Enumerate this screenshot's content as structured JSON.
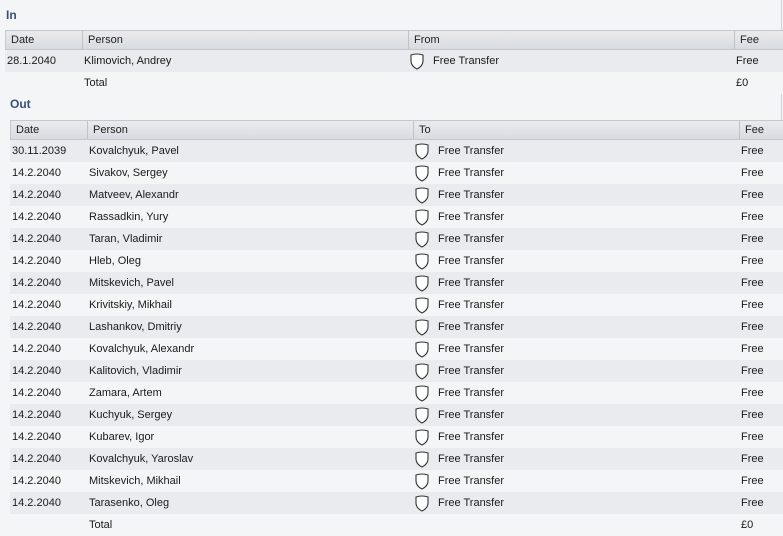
{
  "in_section": {
    "title": "In",
    "headers": {
      "date": "Date",
      "person": "Person",
      "club": "From",
      "fee": "Fee"
    },
    "rows": [
      {
        "date": "28.1.2040",
        "person": "Klimovich, Andrey",
        "club": "Free Transfer",
        "fee": "Free"
      }
    ],
    "total_label": "Total",
    "total_fee": "£0"
  },
  "out_section": {
    "title": "Out",
    "headers": {
      "date": "Date",
      "person": "Person",
      "club": "To",
      "fee": "Fee"
    },
    "rows": [
      {
        "date": "30.11.2039",
        "person": "Kovalchyuk, Pavel",
        "club": "Free Transfer",
        "fee": "Free"
      },
      {
        "date": "14.2.2040",
        "person": "Sivakov, Sergey",
        "club": "Free Transfer",
        "fee": "Free"
      },
      {
        "date": "14.2.2040",
        "person": "Matveev, Alexandr",
        "club": "Free Transfer",
        "fee": "Free"
      },
      {
        "date": "14.2.2040",
        "person": "Rassadkin, Yury",
        "club": "Free Transfer",
        "fee": "Free"
      },
      {
        "date": "14.2.2040",
        "person": "Taran, Vladimir",
        "club": "Free Transfer",
        "fee": "Free"
      },
      {
        "date": "14.2.2040",
        "person": "Hleb, Oleg",
        "club": "Free Transfer",
        "fee": "Free"
      },
      {
        "date": "14.2.2040",
        "person": "Mitskevich, Pavel",
        "club": "Free Transfer",
        "fee": "Free"
      },
      {
        "date": "14.2.2040",
        "person": "Krivitskiy, Mikhail",
        "club": "Free Transfer",
        "fee": "Free"
      },
      {
        "date": "14.2.2040",
        "person": "Lashankov, Dmitriy",
        "club": "Free Transfer",
        "fee": "Free"
      },
      {
        "date": "14.2.2040",
        "person": "Kovalchyuk, Alexandr",
        "club": "Free Transfer",
        "fee": "Free"
      },
      {
        "date": "14.2.2040",
        "person": "Kalitovich, Vladimir",
        "club": "Free Transfer",
        "fee": "Free"
      },
      {
        "date": "14.2.2040",
        "person": "Zamara, Artem",
        "club": "Free Transfer",
        "fee": "Free"
      },
      {
        "date": "14.2.2040",
        "person": "Kuchyuk, Sergey",
        "club": "Free Transfer",
        "fee": "Free"
      },
      {
        "date": "14.2.2040",
        "person": "Kubarev, Igor",
        "club": "Free Transfer",
        "fee": "Free"
      },
      {
        "date": "14.2.2040",
        "person": "Kovalchyuk, Yaroslav",
        "club": "Free Transfer",
        "fee": "Free"
      },
      {
        "date": "14.2.2040",
        "person": "Mitskevich, Mikhail",
        "club": "Free Transfer",
        "fee": "Free"
      },
      {
        "date": "14.2.2040",
        "person": "Tarasenko, Oleg",
        "club": "Free Transfer",
        "fee": "Free"
      }
    ],
    "total_label": "Total",
    "total_fee": "£0"
  },
  "icons": {
    "club_badge": "shield-icon"
  }
}
